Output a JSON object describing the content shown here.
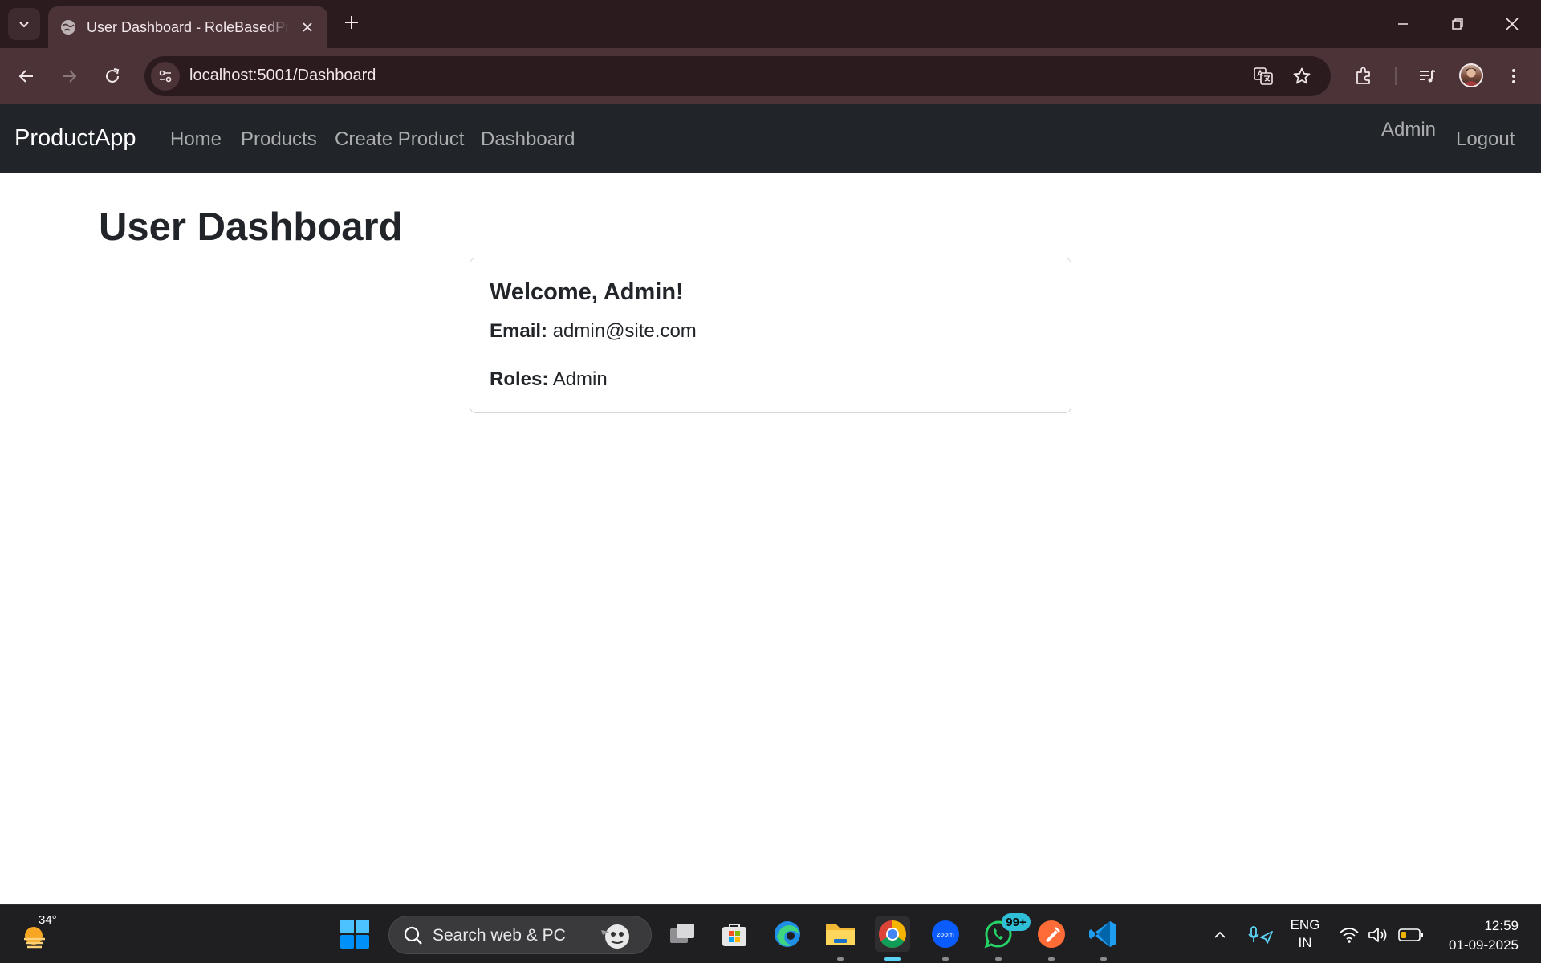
{
  "browser": {
    "tab_title": "User Dashboard - RoleBasedProductApp",
    "url": "localhost:5001/Dashboard"
  },
  "app": {
    "brand": "ProductApp",
    "nav": [
      "Home",
      "Products",
      "Create Product",
      "Dashboard"
    ],
    "user_name": "Admin",
    "logout_label": "Logout"
  },
  "page": {
    "title": "User Dashboard",
    "card": {
      "welcome": "Welcome, Admin!",
      "email_label": "Email:",
      "email_value": "admin@site.com",
      "roles_label": "Roles:",
      "roles_value": "Admin"
    }
  },
  "taskbar": {
    "weather_temp": "34°",
    "search_placeholder": "Search web & PC",
    "whatsapp_badge": "99+",
    "lang_line1": "ENG",
    "lang_line2": "IN",
    "time": "12:59",
    "date": "01-09-2025",
    "apps": [
      "task-view",
      "microsoft-store",
      "edge",
      "file-explorer",
      "chrome",
      "zoom",
      "whatsapp",
      "postman",
      "vscode"
    ]
  },
  "colors": {
    "navbar_bg": "#212529",
    "chrome_frame": "#2b1b1f",
    "chrome_toolbar": "#4b3338",
    "taskbar_bg": "#1f1f21",
    "accent": "#5cd4f5"
  }
}
